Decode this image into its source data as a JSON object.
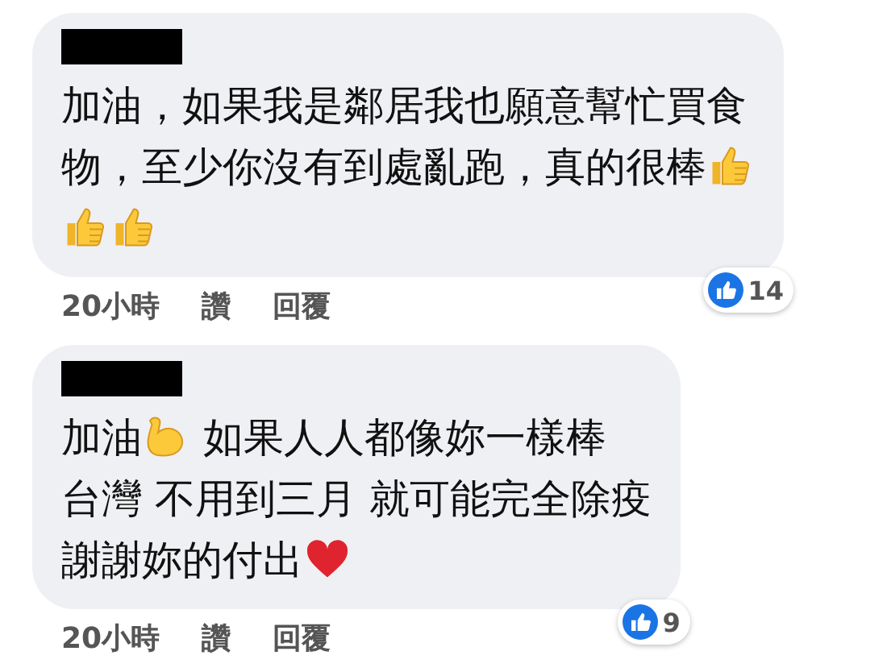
{
  "comments": [
    {
      "lines": [
        [
          {
            "kind": "text",
            "text": "加油，如果我是鄰居我也願意幫忙買食"
          }
        ],
        [
          {
            "kind": "text",
            "text": "物，至少你沒有到處亂跑，真的很棒"
          },
          {
            "kind": "thumb"
          }
        ],
        [
          {
            "kind": "thumb"
          },
          {
            "kind": "thumb"
          }
        ]
      ],
      "time": "20小時",
      "like": "讚",
      "reply": "回覆",
      "reaction_count": "14"
    },
    {
      "lines": [
        [
          {
            "kind": "text",
            "text": "加油"
          },
          {
            "kind": "muscle"
          },
          {
            "kind": "text",
            "text": " 如果人人都像妳一樣棒"
          }
        ],
        [
          {
            "kind": "text",
            "text": "台灣 不用到三月 就可能完全除疫"
          }
        ],
        [
          {
            "kind": "text",
            "text": "謝謝妳的付出"
          },
          {
            "kind": "heart"
          }
        ]
      ],
      "time": "20小時",
      "like": "讚",
      "reply": "回覆",
      "reaction_count": "9"
    }
  ]
}
